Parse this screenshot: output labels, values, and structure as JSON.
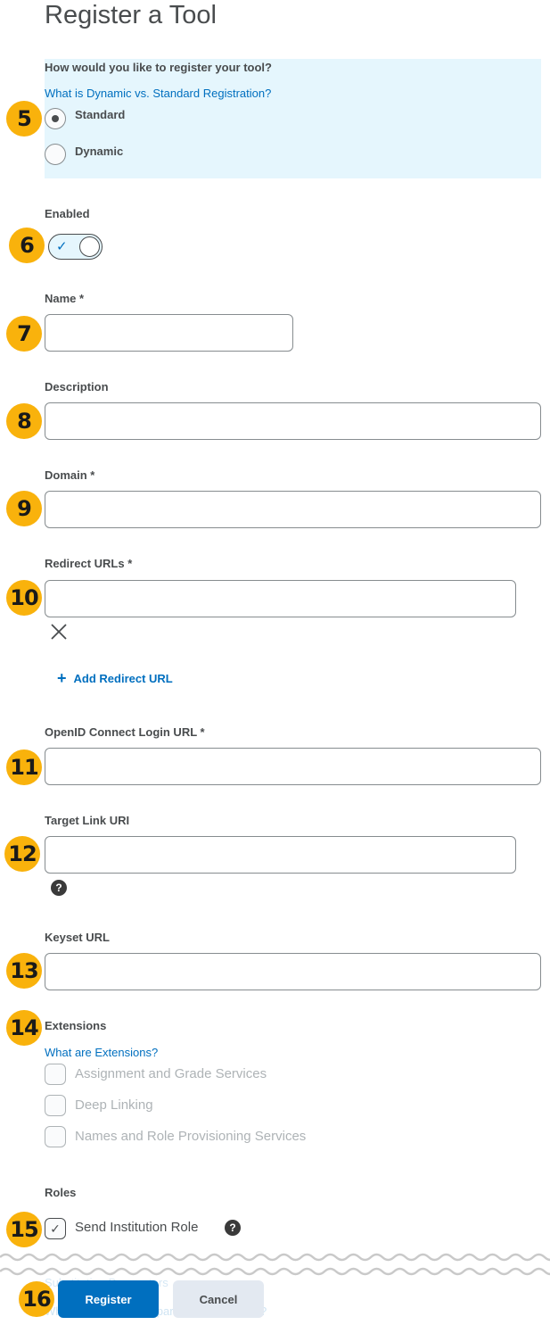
{
  "page": {
    "title": "Register a Tool"
  },
  "registration": {
    "question": "How would you like to register your tool?",
    "help_link": "What is Dynamic vs. Standard Registration?",
    "options": [
      {
        "label": "Standard",
        "selected": true
      },
      {
        "label": "Dynamic",
        "selected": false
      }
    ]
  },
  "enabled": {
    "label": "Enabled",
    "value": true,
    "check_glyph": "✓"
  },
  "fields": {
    "name": {
      "label": "Name *",
      "value": ""
    },
    "description": {
      "label": "Description",
      "value": ""
    },
    "domain": {
      "label": "Domain *",
      "value": ""
    },
    "redirect_urls": {
      "label": "Redirect URLs *",
      "value": "",
      "add_label": "Add Redirect URL",
      "add_glyph": "+"
    },
    "openid_login_url": {
      "label": "OpenID Connect Login URL *",
      "value": ""
    },
    "target_link_uri": {
      "label": "Target Link URI",
      "value": ""
    },
    "keyset_url": {
      "label": "Keyset URL",
      "value": ""
    }
  },
  "extensions": {
    "label": "Extensions",
    "help_link": "What are Extensions?",
    "items": [
      {
        "label": "Assignment and Grade Services",
        "checked": false,
        "disabled": true
      },
      {
        "label": "Deep Linking",
        "checked": false,
        "disabled": true
      },
      {
        "label": "Names and Role Provisioning Services",
        "checked": false,
        "disabled": true
      }
    ]
  },
  "roles": {
    "label": "Roles",
    "send_institution_role": {
      "label": "Send Institution Role",
      "checked": true,
      "check_glyph": "✓"
    }
  },
  "faded_background": {
    "line1": "Substitution Parameters",
    "line2": "What are substitution parameters used for?"
  },
  "actions": {
    "register": "Register",
    "cancel": "Cancel"
  },
  "help_glyph": "?",
  "badges": [
    "5",
    "6",
    "7",
    "8",
    "9",
    "10",
    "11",
    "12",
    "13",
    "14",
    "15",
    "16"
  ],
  "colors": {
    "accent": "#006fbf",
    "panel_bg": "#e5f6fd",
    "badge": "#f9b20c",
    "text": "#494c4e",
    "disabled_text": "#aeb3b6",
    "secondary_button": "#e3e9f1"
  }
}
